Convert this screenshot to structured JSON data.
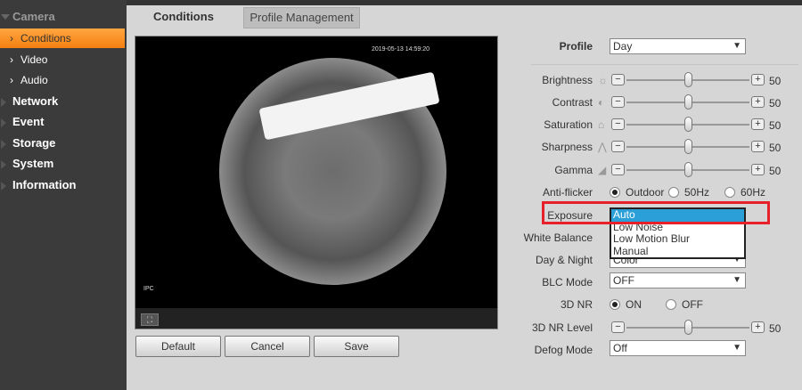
{
  "sidebar": {
    "camera": "Camera",
    "conditions": "Conditions",
    "video": "Video",
    "audio": "Audio",
    "network": "Network",
    "event": "Event",
    "storage": "Storage",
    "system": "System",
    "information": "Information"
  },
  "tabs": {
    "conditions": "Conditions",
    "profile_management": "Profile Management"
  },
  "video": {
    "timestamp": "2019-05-13 14:59:20",
    "channel": "IPC"
  },
  "buttons": {
    "default": "Default",
    "cancel": "Cancel",
    "save": "Save"
  },
  "form": {
    "profile": {
      "label": "Profile",
      "value": "Day"
    },
    "brightness": {
      "label": "Brightness",
      "value": "50"
    },
    "contrast": {
      "label": "Contrast",
      "value": "50"
    },
    "saturation": {
      "label": "Saturation",
      "value": "50"
    },
    "sharpness": {
      "label": "Sharpness",
      "value": "50"
    },
    "gamma": {
      "label": "Gamma",
      "value": "50"
    },
    "antiflicker": {
      "label": "Anti-flicker",
      "options": [
        "Outdoor",
        "50Hz",
        "60Hz"
      ],
      "selected": "Outdoor"
    },
    "exposure": {
      "label": "Exposure",
      "options": [
        "Auto",
        "Low Noise",
        "Low Motion Blur",
        "Manual"
      ],
      "selected": "Auto"
    },
    "white_balance": {
      "label": "White Balance"
    },
    "day_night": {
      "label": "Day & Night",
      "value": "Color"
    },
    "blc": {
      "label": "BLC Mode",
      "value": "OFF"
    },
    "nr3d": {
      "label": "3D NR",
      "options": [
        "ON",
        "OFF"
      ],
      "selected": "ON"
    },
    "nr3d_level": {
      "label": "3D NR Level",
      "value": "50"
    },
    "defog": {
      "label": "Defog Mode",
      "value": "Off"
    }
  },
  "colors": {
    "accent": "#f58a1f",
    "highlight": "#e8202a",
    "selection": "#2a9fd8"
  }
}
